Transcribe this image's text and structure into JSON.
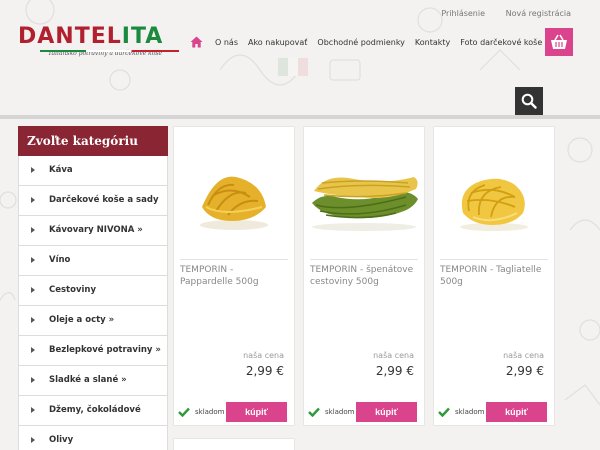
{
  "header": {
    "logo_text_red": "DANTEL",
    "logo_text_green": "ITA",
    "logo_tagline": "Taliansko potraviny a darčekové koše",
    "top_links": [
      "Prihlásenie",
      "Nová registrácia"
    ],
    "nav": [
      "O nás",
      "Ako nakupovať",
      "Obchodné podmienky",
      "Kontakty",
      "Foto darčekové koše"
    ]
  },
  "sidebar": {
    "title": "Zvoľte kategóriu",
    "items": [
      {
        "label": "Káva"
      },
      {
        "label": "Darčekové koše a sady"
      },
      {
        "label": "Kávovary NIVONA »"
      },
      {
        "label": "Víno"
      },
      {
        "label": "Cestoviny"
      },
      {
        "label": "Oleje a octy »"
      },
      {
        "label": "Bezlepkové potraviny »"
      },
      {
        "label": "Sladké a slané »"
      },
      {
        "label": "Džemy, čokoládové"
      },
      {
        "label": "Olivy"
      }
    ]
  },
  "products": [
    {
      "name": "TEMPORIN - Pappardelle 500g",
      "price_label": "naša cena",
      "price": "2,99 €",
      "stock": "skladom",
      "buy": "kúpiť"
    },
    {
      "name": "TEMPORIN - špenátove cestoviny 500g",
      "price_label": "naša cena",
      "price": "2,99 €",
      "stock": "skladom",
      "buy": "kúpiť"
    },
    {
      "name": "TEMPORIN - Tagliatelle 500g",
      "price_label": "naša cena",
      "price": "2,99 €",
      "stock": "skladom",
      "buy": "kúpiť"
    }
  ],
  "colors": {
    "brand_red": "#b0202e",
    "brand_green": "#1b8a3e",
    "accent_pink": "#d9448d",
    "sidebar_header": "#8a2634",
    "search_dark": "#333333"
  },
  "icons": {
    "home": "home-icon",
    "cart": "cart-basket-icon",
    "search": "search-icon",
    "stock": "checkmark-icon",
    "category_arrow": "triangle-right-icon"
  }
}
